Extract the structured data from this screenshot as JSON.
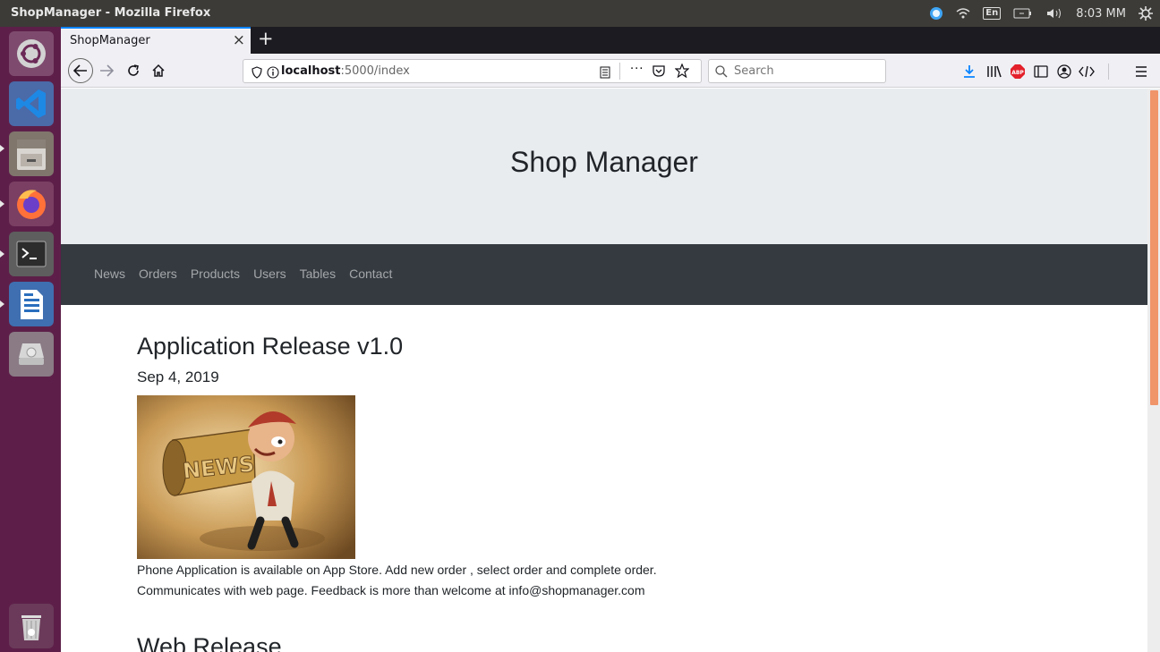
{
  "topbar": {
    "window_title": "ShopManager - Mozilla Firefox",
    "keyboard_layout": "En",
    "clock": "8:03 MM"
  },
  "launcher": {
    "apps": [
      "ubuntu-dash-icon",
      "vscode-icon",
      "file-manager-icon",
      "firefox-icon",
      "terminal-icon",
      "libreoffice-writer-icon",
      "disk-drive-icon",
      "trash-icon"
    ],
    "bg_color": "#5d1f49"
  },
  "browser": {
    "tab_title": "ShopManager",
    "tab_close": "×",
    "new_tab": "+",
    "url_host": "localhost",
    "url_rest": ":5000/index",
    "search_placeholder": "Search",
    "menu_dots": "···"
  },
  "page": {
    "site_title": "Shop Manager",
    "nav": [
      "News",
      "Orders",
      "Products",
      "Users",
      "Tables",
      "Contact"
    ],
    "posts": [
      {
        "title": "Application Release v1.0",
        "date": "Sep 4, 2019",
        "image_text": "NEWS",
        "body_line1": "Phone Application is available on App Store. Add new order , select order and complete order.",
        "body_line2": "Communicates with web page. Feedback is more than welcome at info@shopmanager.com"
      },
      {
        "title": "Web Release"
      }
    ]
  },
  "colors": {
    "jumbotron": "#e9ecef",
    "navbar": "#343a40",
    "accent": "#0a84ff",
    "scroll_thumb": "#f0946a"
  }
}
